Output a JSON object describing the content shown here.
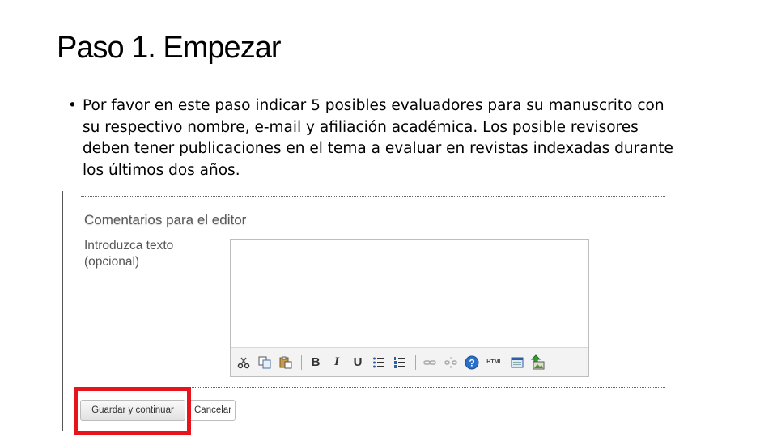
{
  "slide": {
    "title": "Paso 1. Empezar",
    "bullet_symbol": "•",
    "bullet_text": "Por favor en este paso indicar 5 posibles evaluadores para su manuscrito con su respectivo nombre, e-mail y afiliación académica. Los posible revisores deben tener publicaciones en el tema a evaluar en revistas indexadas durante los últimos dos años."
  },
  "form": {
    "section_title": "Comentarios para el editor",
    "field_label": "Introduzca texto (opcional)",
    "editor_value": "",
    "toolbar_icons": [
      "cut-icon",
      "copy-icon",
      "paste-icon",
      "bold-icon",
      "italic-icon",
      "underline-icon",
      "bullet-list-icon",
      "numbered-list-icon",
      "link-icon",
      "unlink-icon",
      "help-icon",
      "html-icon",
      "fullscreen-icon",
      "upload-image-icon"
    ],
    "toolbar_text": {
      "bold": "B",
      "italic": "I",
      "underline": "U",
      "help": "?",
      "html": "HTML"
    },
    "save_button": "Guardar y continuar",
    "cancel_button": "Cancelar"
  },
  "colors": {
    "highlight": "#e8141b",
    "help_blue": "#2a6fc9"
  }
}
